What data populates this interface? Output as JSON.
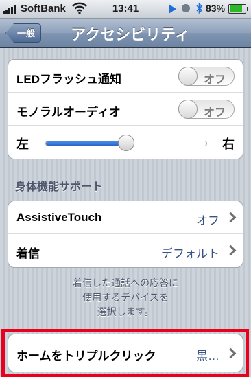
{
  "status_bar": {
    "carrier": "SoftBank",
    "time": "13:41",
    "battery_percent": "83%",
    "battery_level": 0.83,
    "icons": [
      "signal-icon",
      "wifi-icon",
      "play-icon",
      "orientation-lock-icon",
      "bluetooth-icon",
      "battery-icon"
    ]
  },
  "nav": {
    "back_label": "一般",
    "title": "アクセシビリティ"
  },
  "group1": {
    "led_flash": {
      "label": "LEDフラッシュ通知",
      "toggle": "オフ"
    },
    "mono_audio": {
      "label": "モノラルオーディオ",
      "toggle": "オフ"
    },
    "balance": {
      "left": "左",
      "right": "右",
      "value": 0.5
    }
  },
  "physical_support": {
    "header": "身体機能サポート",
    "assistive_touch": {
      "label": "AssistiveTouch",
      "value": "オフ"
    },
    "incoming_call": {
      "label": "着信",
      "value": "デフォルト"
    },
    "footer_lines": [
      "着信した通話への応答に",
      "使用するデバイスを",
      "選択します。"
    ]
  },
  "triple_click": {
    "label": "ホームをトリプルクリック",
    "value": "黒…"
  },
  "colors": {
    "nav": "#6c83a3",
    "value_text": "#385487",
    "highlight": "#e8001c",
    "slider_fill": "#2c63c9"
  }
}
